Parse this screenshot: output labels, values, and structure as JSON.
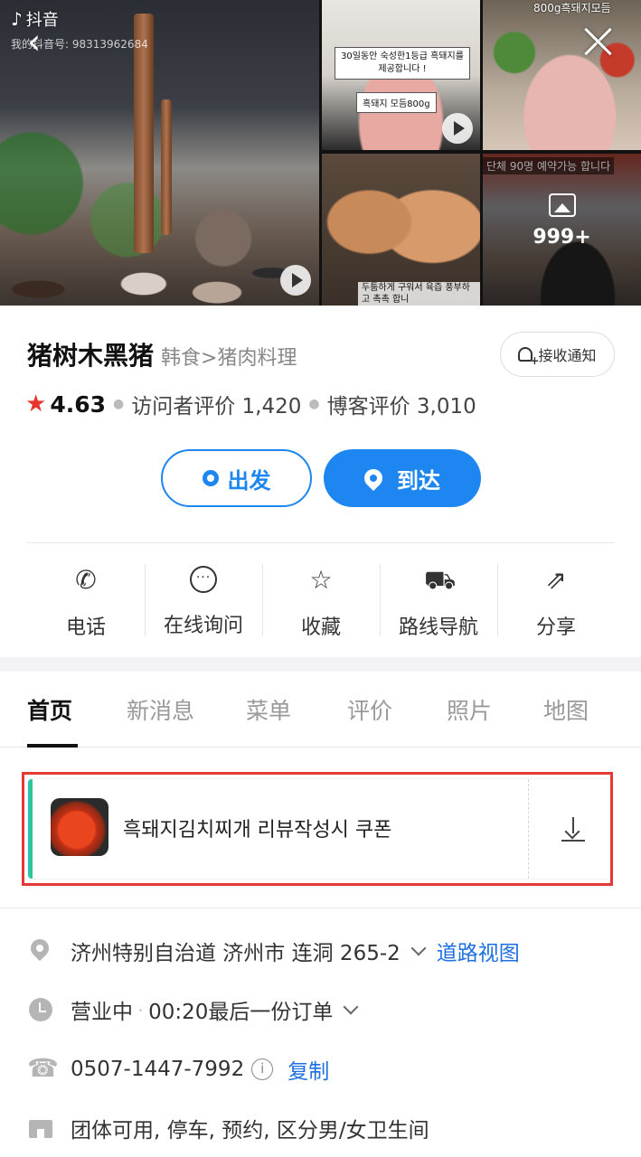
{
  "gallery": {
    "watermark_app": "抖音",
    "watermark_id": "我的抖音号: 98313962684",
    "t1_caption": "30일동안 숙성한1등급 흑돼지를 제공합니다 !",
    "t1_caption2": "흑돼지 모듬800g",
    "t2_caption": "800g흑돼지모듬",
    "b1_caption": "두툼하게 구워서 육즙 풍부하고 촉촉 합니",
    "b2_caption": "단체 90명 예약가능 합니다",
    "more_count": "999+"
  },
  "header": {
    "name": "猪树木黑猪",
    "category": "韩食>猪肉料理",
    "notify_label": "接收通知",
    "rating": "4.63",
    "visitor_reviews": "访问者评价 1,420",
    "blog_reviews": "博客评价 3,010"
  },
  "route": {
    "depart_label": "出发",
    "arrive_label": "到达"
  },
  "actions": [
    {
      "label": "电话",
      "icon": "phone-icon"
    },
    {
      "label": "在线询问",
      "icon": "chat-icon"
    },
    {
      "label": "收藏",
      "icon": "star-icon"
    },
    {
      "label": "路线导航",
      "icon": "car-icon"
    },
    {
      "label": "分享",
      "icon": "share-icon"
    }
  ],
  "tabs": [
    {
      "label": "首页",
      "active": true
    },
    {
      "label": "新消息"
    },
    {
      "label": "菜单"
    },
    {
      "label": "评价"
    },
    {
      "label": "照片"
    },
    {
      "label": "地图"
    }
  ],
  "coupon": {
    "text": "흑돼지김치찌개 리뷰작성시 쿠폰"
  },
  "info": {
    "address": "济州特别自治道 济州市 连洞 265-2",
    "street_view": "道路视图",
    "status": "营业中",
    "last_order": "00:20最后一份订单",
    "phone": "0507-1447-7992",
    "copy": "复制",
    "amenities": "团体可用, 停车, 预约, 区分男/女卫生间"
  },
  "colors": {
    "accent": "#1e86f0",
    "rating_star": "#e8352d",
    "highlight": "#e53935",
    "coupon_stripe": "#2ec4a0"
  }
}
